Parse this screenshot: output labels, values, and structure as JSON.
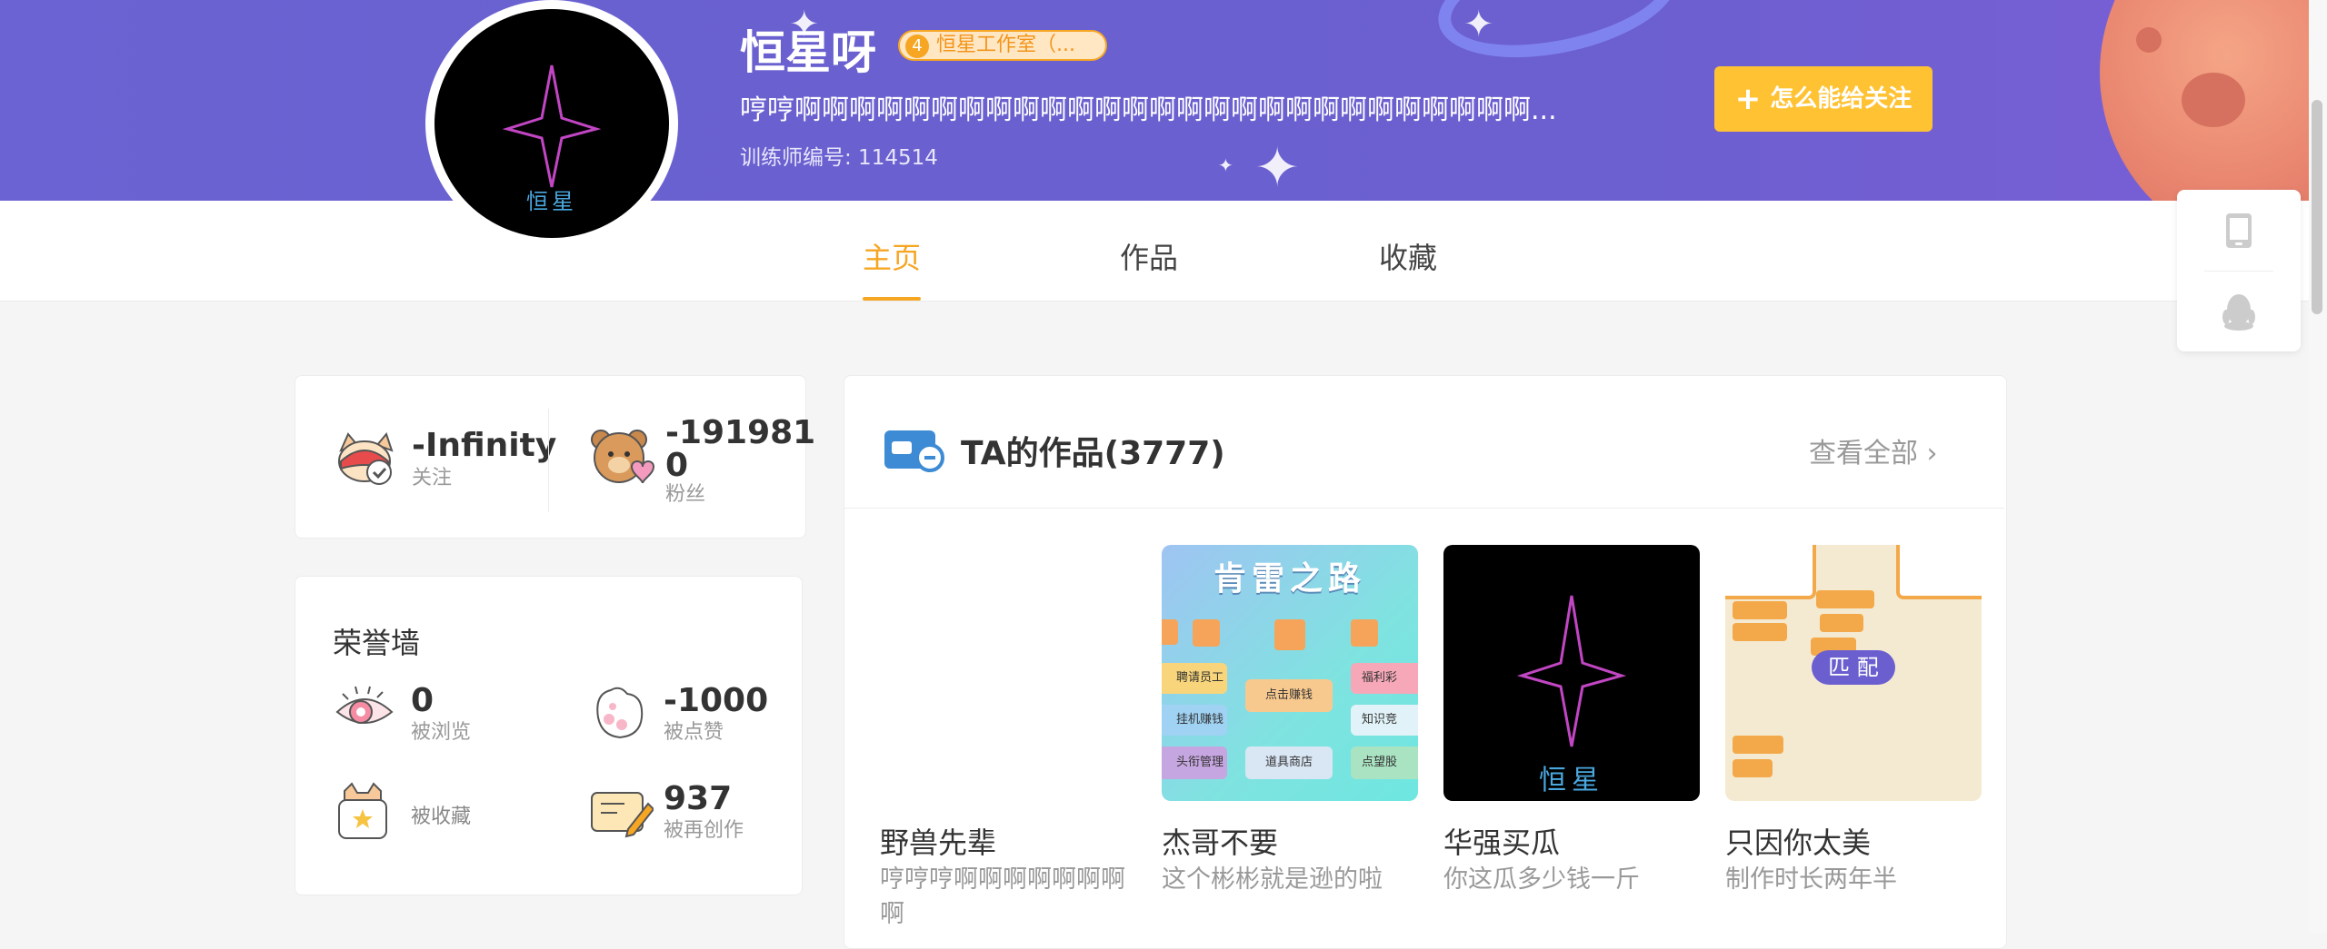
{
  "profile": {
    "name": "恒星呀",
    "studio_badge_num": "4",
    "studio_badge": "恒星工作室（...",
    "bio": "哼哼啊啊啊啊啊啊啊啊啊啊啊啊啊啊啊啊啊啊啊啊啊啊啊啊啊啊啊...",
    "trainer_id": "训练师编号: 114514",
    "avatar_text": "恒星",
    "follow_button": "怎么能给关注"
  },
  "tabs": [
    {
      "label": "主页",
      "active": true
    },
    {
      "label": "作品",
      "active": false
    },
    {
      "label": "收藏",
      "active": false
    }
  ],
  "stats": {
    "following_value": "-Infinity",
    "following_label": "关注",
    "fans_value_line1": "-191981",
    "fans_value_line2": "0",
    "fans_label": "粉丝"
  },
  "honor": {
    "title": "荣誉墙",
    "views_value": "0",
    "views_label": "被浏览",
    "likes_value": "-1000",
    "likes_label": "被点赞",
    "favorites_label": "被收藏",
    "recreate_value": "937",
    "recreate_label": "被再创作"
  },
  "works": {
    "title": "TA的作品(3777)",
    "see_all": "查看全部",
    "items": [
      {
        "title": "野兽先辈",
        "desc_line1": "哼哼哼啊啊啊啊啊啊啊",
        "desc_line2": "啊"
      },
      {
        "title": "杰哥不要",
        "desc_line1": "这个彬彬就是逊的啦"
      },
      {
        "title": "华强买瓜",
        "desc_line1": "你这瓜多少钱一斤"
      },
      {
        "title": "只因你太美",
        "desc_line1": "制作时长两年半"
      }
    ],
    "thumb2": {
      "heading": "肯雷之路",
      "buttons": [
        "聘请员工",
        "点击赚钱",
        "福利彩",
        "挂机赚钱",
        "知识竞",
        "头衔管理",
        "道具商店",
        "点望股"
      ]
    },
    "thumb3": {
      "text": "恒星"
    },
    "thumb4": {
      "match_label": "匹 配"
    }
  },
  "colors": {
    "accent": "#f6a623",
    "banner": "#6a60cf",
    "follow_button": "#ffc233"
  },
  "icons": {
    "side_float": [
      "phone-icon",
      "qq-penguin-icon"
    ]
  }
}
